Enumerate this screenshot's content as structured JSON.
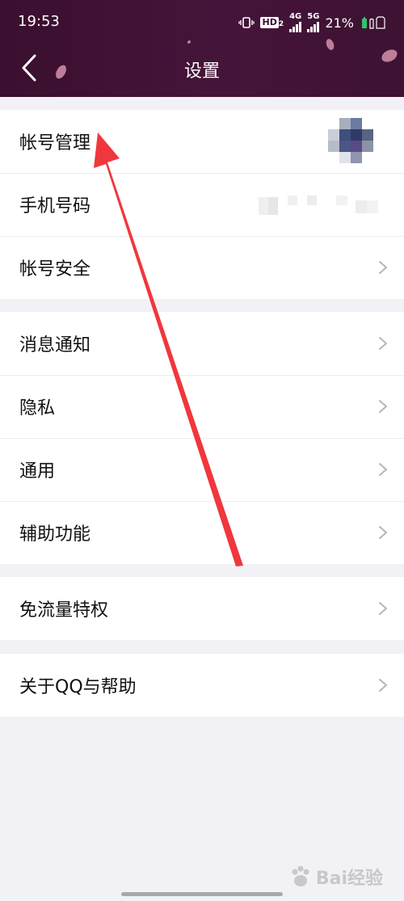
{
  "status_bar": {
    "time": "19:53",
    "hd_badge": "HD",
    "hd_sub": "2",
    "network_4g": "4G",
    "network_5g": "5G",
    "battery_percent": "21%"
  },
  "nav": {
    "title": "设置",
    "back_icon": "chevron-left-icon"
  },
  "groups": [
    {
      "items": [
        {
          "label": "帐号管理",
          "trailing": "blurred-avatar"
        },
        {
          "label": "手机号码",
          "trailing": "blurred-phone"
        },
        {
          "label": "帐号安全",
          "trailing": "chevron-right-icon"
        }
      ]
    },
    {
      "items": [
        {
          "label": "消息通知",
          "trailing": "chevron-right-icon"
        },
        {
          "label": "隐私",
          "trailing": "chevron-right-icon"
        },
        {
          "label": "通用",
          "trailing": "chevron-right-icon"
        },
        {
          "label": "辅助功能",
          "trailing": "chevron-right-icon"
        }
      ]
    },
    {
      "items": [
        {
          "label": "免流量特权",
          "trailing": "chevron-right-icon"
        }
      ]
    },
    {
      "items": [
        {
          "label": "关于QQ与帮助",
          "trailing": "chevron-right-icon"
        }
      ]
    }
  ],
  "watermark": {
    "text": "Bai经验"
  },
  "colors": {
    "header_bg": "#3a0f2f",
    "page_bg": "#f2f2f6",
    "chevron": "#b5b5bb",
    "annotation_arrow": "#f0373d"
  }
}
